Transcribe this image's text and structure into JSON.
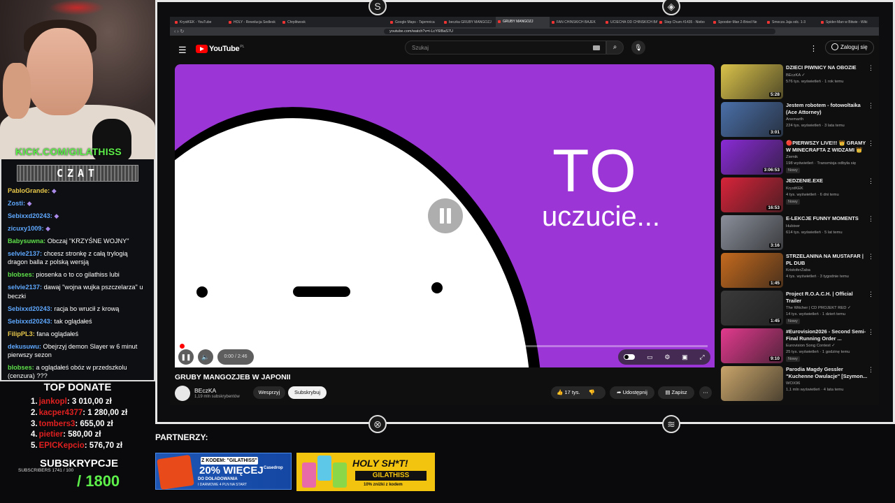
{
  "stream": {
    "kick_handle": "KICK.COM/GILATHISS",
    "chat_title": "CZAT",
    "chat": [
      {
        "user": "PabloGrande:",
        "text": "",
        "color": "#e8c84a"
      },
      {
        "user": "Zosti:",
        "text": "",
        "color": "#5ea8ff"
      },
      {
        "user": "Sebixxd20243:",
        "text": "",
        "color": "#5ea8ff"
      },
      {
        "user": "zicuxy1009:",
        "text": "",
        "color": "#5ea8ff"
      },
      {
        "user": "Babysuwna:",
        "text": "Obczaj \"KRZYŚNE WOJNY\"",
        "color": "#5ee04a"
      },
      {
        "user": "selvie2137:",
        "text": "chcesz stronkę z całą trylogią dragon balla z polską wersją",
        "color": "#5ea8ff"
      },
      {
        "user": "blobses:",
        "text": "piosenka o to co gilathiss lubi",
        "color": "#5ee04a"
      },
      {
        "user": "selvie2137:",
        "text": "dawaj \"wojna wujka pszczelarza\" u beczki",
        "color": "#5ea8ff"
      },
      {
        "user": "Sebixxd20243:",
        "text": "racja bo wrucił z krową",
        "color": "#5ea8ff"
      },
      {
        "user": "Sebixxd20243:",
        "text": "tak oglądałeś",
        "color": "#5ea8ff"
      },
      {
        "user": "FilipPL3:",
        "text": "fana oglądałeś",
        "color": "#e8c84a"
      },
      {
        "user": "dekusuwu:",
        "text": "Obejrzyj demon Slayer w 6 minut pierwszy sezon",
        "color": "#5ea8ff"
      },
      {
        "user": "blobses:",
        "text": "a oglądałeś obóz w przedszkolu (cenzura) ???",
        "color": "#5ee04a"
      }
    ],
    "top_donate_title": "TOP DONATE",
    "donations": [
      {
        "rank": "1.",
        "name": "jankopl",
        "amount": ": 3 010,00 zł"
      },
      {
        "rank": "2.",
        "name": "kacper4377",
        "amount": ": 1 280,00 zł"
      },
      {
        "rank": "3.",
        "name": "tombers3",
        "amount": ": 655,00 zł"
      },
      {
        "rank": "4.",
        "name": "pietier",
        "amount": ": 580,00 zł"
      },
      {
        "rank": "5.",
        "name": "EPICKepcio",
        "amount": ": 576,70 zł"
      }
    ],
    "subs_title": "SUBSKRYPCJE",
    "subs_small": "SUBSCRIBERS 1741 / 100",
    "subs_goal": "/ 1800",
    "partners_label": "PARTNERZY:",
    "banner1": {
      "code": "Z KODEM: \"GILATHISS\"",
      "big": "20% WIĘCEJ",
      "line1": "DO DOŁADOWANIA",
      "line2": "I DARMOWE 4 PLN NA START",
      "brand": "Casedrop"
    },
    "banner2": {
      "headline": "HOLY SH*T!",
      "code": "GILATHISS",
      "note": "10% zniżki z kodem"
    }
  },
  "browser": {
    "tabs": [
      "KrystKEK - YouTube",
      "HOLY - Rewolucja Sedlesk",
      "Chrplitwosk",
      "",
      "Google Maps - Tajemnica",
      "beczka GRUBY MANGOZJ",
      "GRUBY MANGOZJ",
      "FAN CHIŃSKICH BAJEK",
      "UCIECHA OD CHIŃSKICH BA",
      "Step Chum #1435 - Niebo",
      "Spooder-Man 2-Bried Ne",
      "Smocza Jaja odc. 1-3",
      "Spider-Man w Bitwie - Wiki"
    ],
    "active_tab": 6,
    "url": "youtube.com/watch?v=i-LcY6IBaS7U"
  },
  "youtube": {
    "logo": "YouTube",
    "country": "PL",
    "search_placeholder": "Szukaj",
    "login": "Zaloguj się",
    "video": {
      "caption_big": "TO",
      "caption_small": "uczucie...",
      "time": "0:00 / 2:46",
      "progress": 0.0,
      "buffered": 0.3,
      "title": "GRUBY MANGOZJEB W JAPONII",
      "channel": "BEczKA",
      "subscribers": "1,19 mln subskrybentów",
      "support": "Wesprzyj",
      "subscribe": "Subskrybuj",
      "likes": "17 tys.",
      "share": "Udostępnij",
      "save": "Zapisz"
    },
    "recommended": [
      {
        "title": "DZIECI PIWNICY NA OBOZIE",
        "channel": "BEczKA ✓",
        "meta": "576 tys. wyświetleń · 1 rok temu",
        "duration": "5:28",
        "badge": "",
        "color": "#d9c24a"
      },
      {
        "title": "Jestem robotem - fotowoltaika (Ace Attorney)",
        "channel": "Anemarth",
        "meta": "224 tys. wyświetleń · 3 lata temu",
        "duration": "3:01",
        "badge": "",
        "color": "#4a6fa8"
      },
      {
        "title": "🔴PIERWSZY LIVE!!! 👑 GRAMY W MINECRAFTA Z WIDZAMI 👑",
        "channel": "Ziemik",
        "meta": "198 wyświetleń · Transmisja odbyła się",
        "duration": "3:06:53",
        "badge": "Nowy",
        "color": "#8a2bd6"
      },
      {
        "title": "JEDZENIE.EXE",
        "channel": "KrystKEK",
        "meta": "4 tys. wyświetleń · 6 dni temu",
        "duration": "16:53",
        "badge": "Nowy",
        "color": "#d8243a"
      },
      {
        "title": "E-LEKCJE FUNNY MOMENTS",
        "channel": "Hubixer",
        "meta": "614 tys. wyświetleń · 5 lat temu",
        "duration": "3:16",
        "badge": "",
        "color": "#8a8f9a"
      },
      {
        "title": "STRZELANINA NA MUSTAFAR | PL DUB",
        "channel": "KristoferŻaba",
        "meta": "4 tys. wyświetleń · 3 tygodnie temu",
        "duration": "1:45",
        "badge": "",
        "color": "#c46a1e"
      },
      {
        "title": "Project R.O.A.C.H. | Official Trailer",
        "channel": "The Witcher | CD PROJEKT RED ✓",
        "meta": "14 tys. wyświetleń · 1 dzień temu",
        "duration": "1:45",
        "badge": "Nowy",
        "color": "#3a3a3a"
      },
      {
        "title": "#Eurovision2026 - Second Semi-Final Running Order ...",
        "channel": "Eurovision Song Contest ✓",
        "meta": "25 tys. wyświetleń · 1 godzinę temu",
        "duration": "9:10",
        "badge": "Nowy",
        "color": "#e23a8e"
      },
      {
        "title": "Parodia Magdy Gessler \"Kuchenne Owulacje\" [Szymon...",
        "channel": "WOX96",
        "meta": "1,1 mln wyświetleń · 4 lata temu",
        "duration": "",
        "badge": "",
        "color": "#c9a56a"
      }
    ]
  }
}
